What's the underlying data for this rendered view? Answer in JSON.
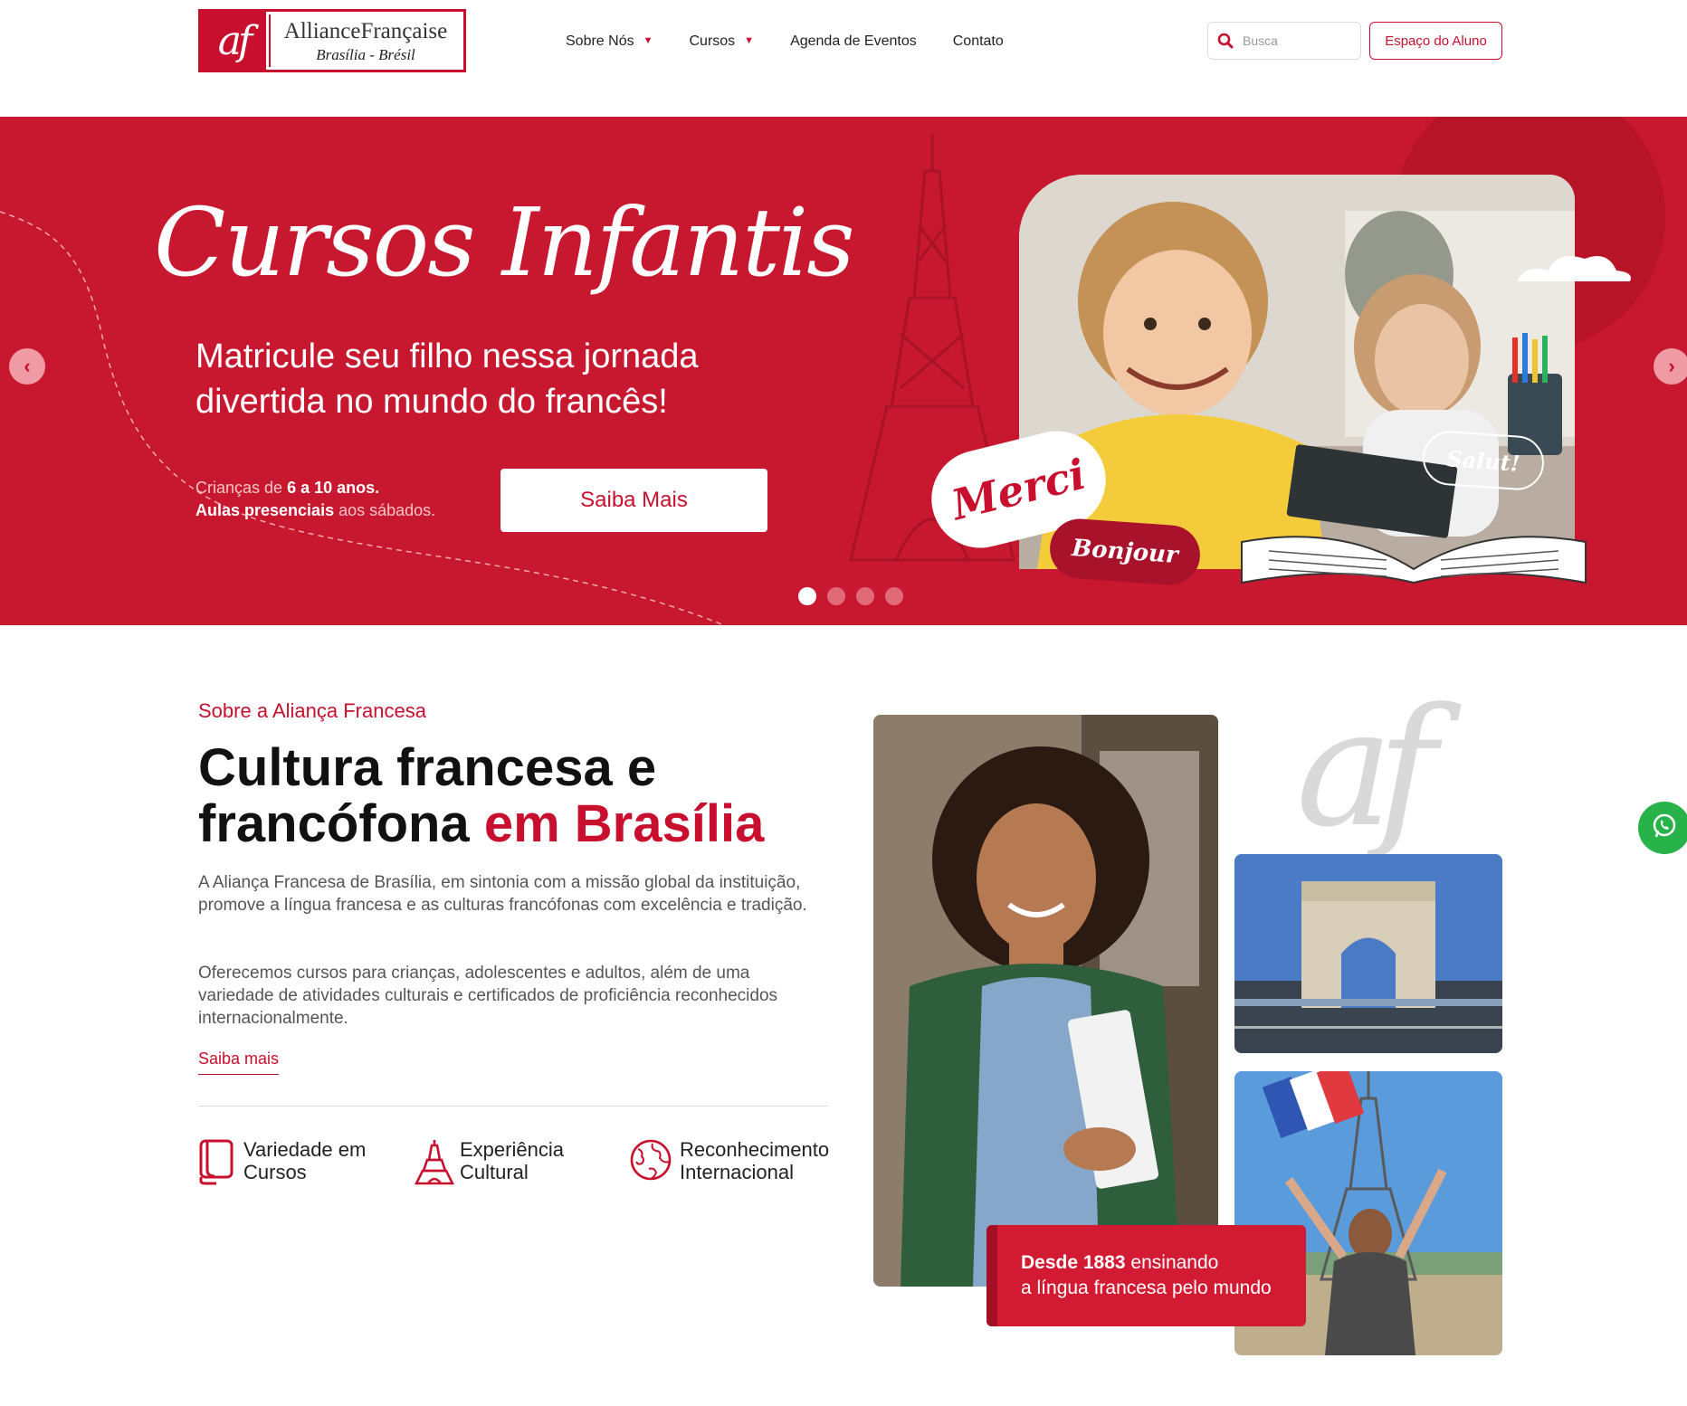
{
  "header": {
    "logo": {
      "mark": "af",
      "title": "AllianceFrançaise",
      "subtitle": "Brasília - Brésil"
    },
    "nav": [
      {
        "label": "Sobre Nós",
        "has_dropdown": true
      },
      {
        "label": "Cursos",
        "has_dropdown": true
      },
      {
        "label": "Agenda de Eventos",
        "has_dropdown": false
      },
      {
        "label": "Contato",
        "has_dropdown": false
      }
    ],
    "search": {
      "placeholder": "Busca",
      "value": "",
      "icon": "search-icon"
    },
    "student_button": "Espaço do Aluno"
  },
  "hero": {
    "title": "Cursos Infantis",
    "subtitle": "Matricule seu filho nessa jornada divertida no mundo do francês!",
    "note_prefix": "Crianças de ",
    "note_age": "6 a 10 anos.",
    "note_line2_bold": "Aulas presenciais",
    "note_line2_rest": " aos sábados.",
    "cta": "Saiba Mais",
    "bubbles": {
      "merci": "Merci",
      "bonjour": "Bonjour",
      "salut": "Salut!"
    },
    "slides": {
      "count": 4,
      "active": 1
    },
    "colors": {
      "background": "#c8182f",
      "accent": "#c8102e"
    }
  },
  "about": {
    "eyebrow": "Sobre a Aliança Francesa",
    "title_part1": "Cultura francesa e francófona ",
    "title_part2": "em Brasília",
    "paragraph1": "A Aliança Francesa de Brasília, em sintonia com a missão global da instituição, promove a língua francesa e as culturas francófonas com excelência e tradição.",
    "paragraph2": "Oferecemos cursos para crianças, adolescentes e adultos, além de uma variedade de atividades culturais e certificados de proficiência reconhecidos internacionalmente.",
    "link": "Saiba mais",
    "features": [
      {
        "icon": "book-icon",
        "line1": "Variedade em",
        "line2": "Cursos"
      },
      {
        "icon": "eiffel-tower-icon",
        "line1": "Experiência",
        "line2": "Cultural"
      },
      {
        "icon": "globe-icon",
        "line1": "Reconhecimento",
        "line2": "Internacional"
      }
    ]
  },
  "collage": {
    "watermark": "af",
    "since_bold": "Desde 1883",
    "since_rest1": " ensinando",
    "since_line2": "a língua francesa pelo mundo"
  },
  "floating": {
    "whatsapp_icon": "whatsapp-icon"
  }
}
